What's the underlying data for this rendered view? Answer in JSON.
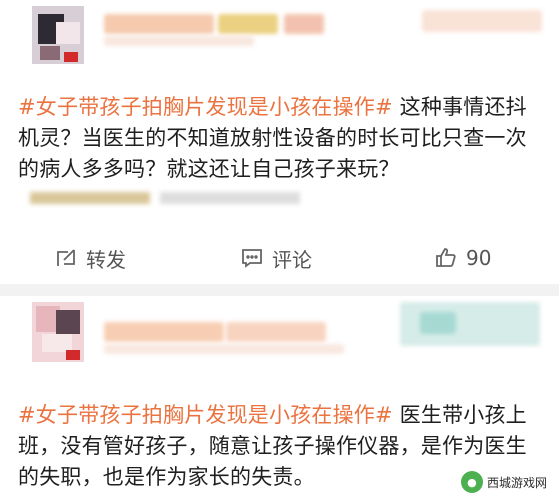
{
  "post1": {
    "hashtag": "#女子带孩子拍胸片发现是小孩在操作#",
    "text": " 这种事情还抖机灵？当医生的不知道放射性设备的时长可比只查一次的病人多多吗？就这还让自己孩子来玩？",
    "actions": {
      "repost_label": "转发",
      "comment_label": "评论",
      "like_count": "90"
    }
  },
  "post2": {
    "hashtag": "#女子带孩子拍胸片发现是小孩在操作#",
    "text": " 医生带小孩上班，没有管好孩子，随意让孩子操作仪器，是作为医生的失职，也是作为家长的失责。"
  },
  "watermark": {
    "site_name": "西城游戏网"
  },
  "colors": {
    "hashtag": "#eb7340",
    "action_text": "#555555",
    "divider": "#f2f2f2"
  },
  "icons": [
    "repost-icon",
    "comment-icon",
    "like-icon"
  ]
}
